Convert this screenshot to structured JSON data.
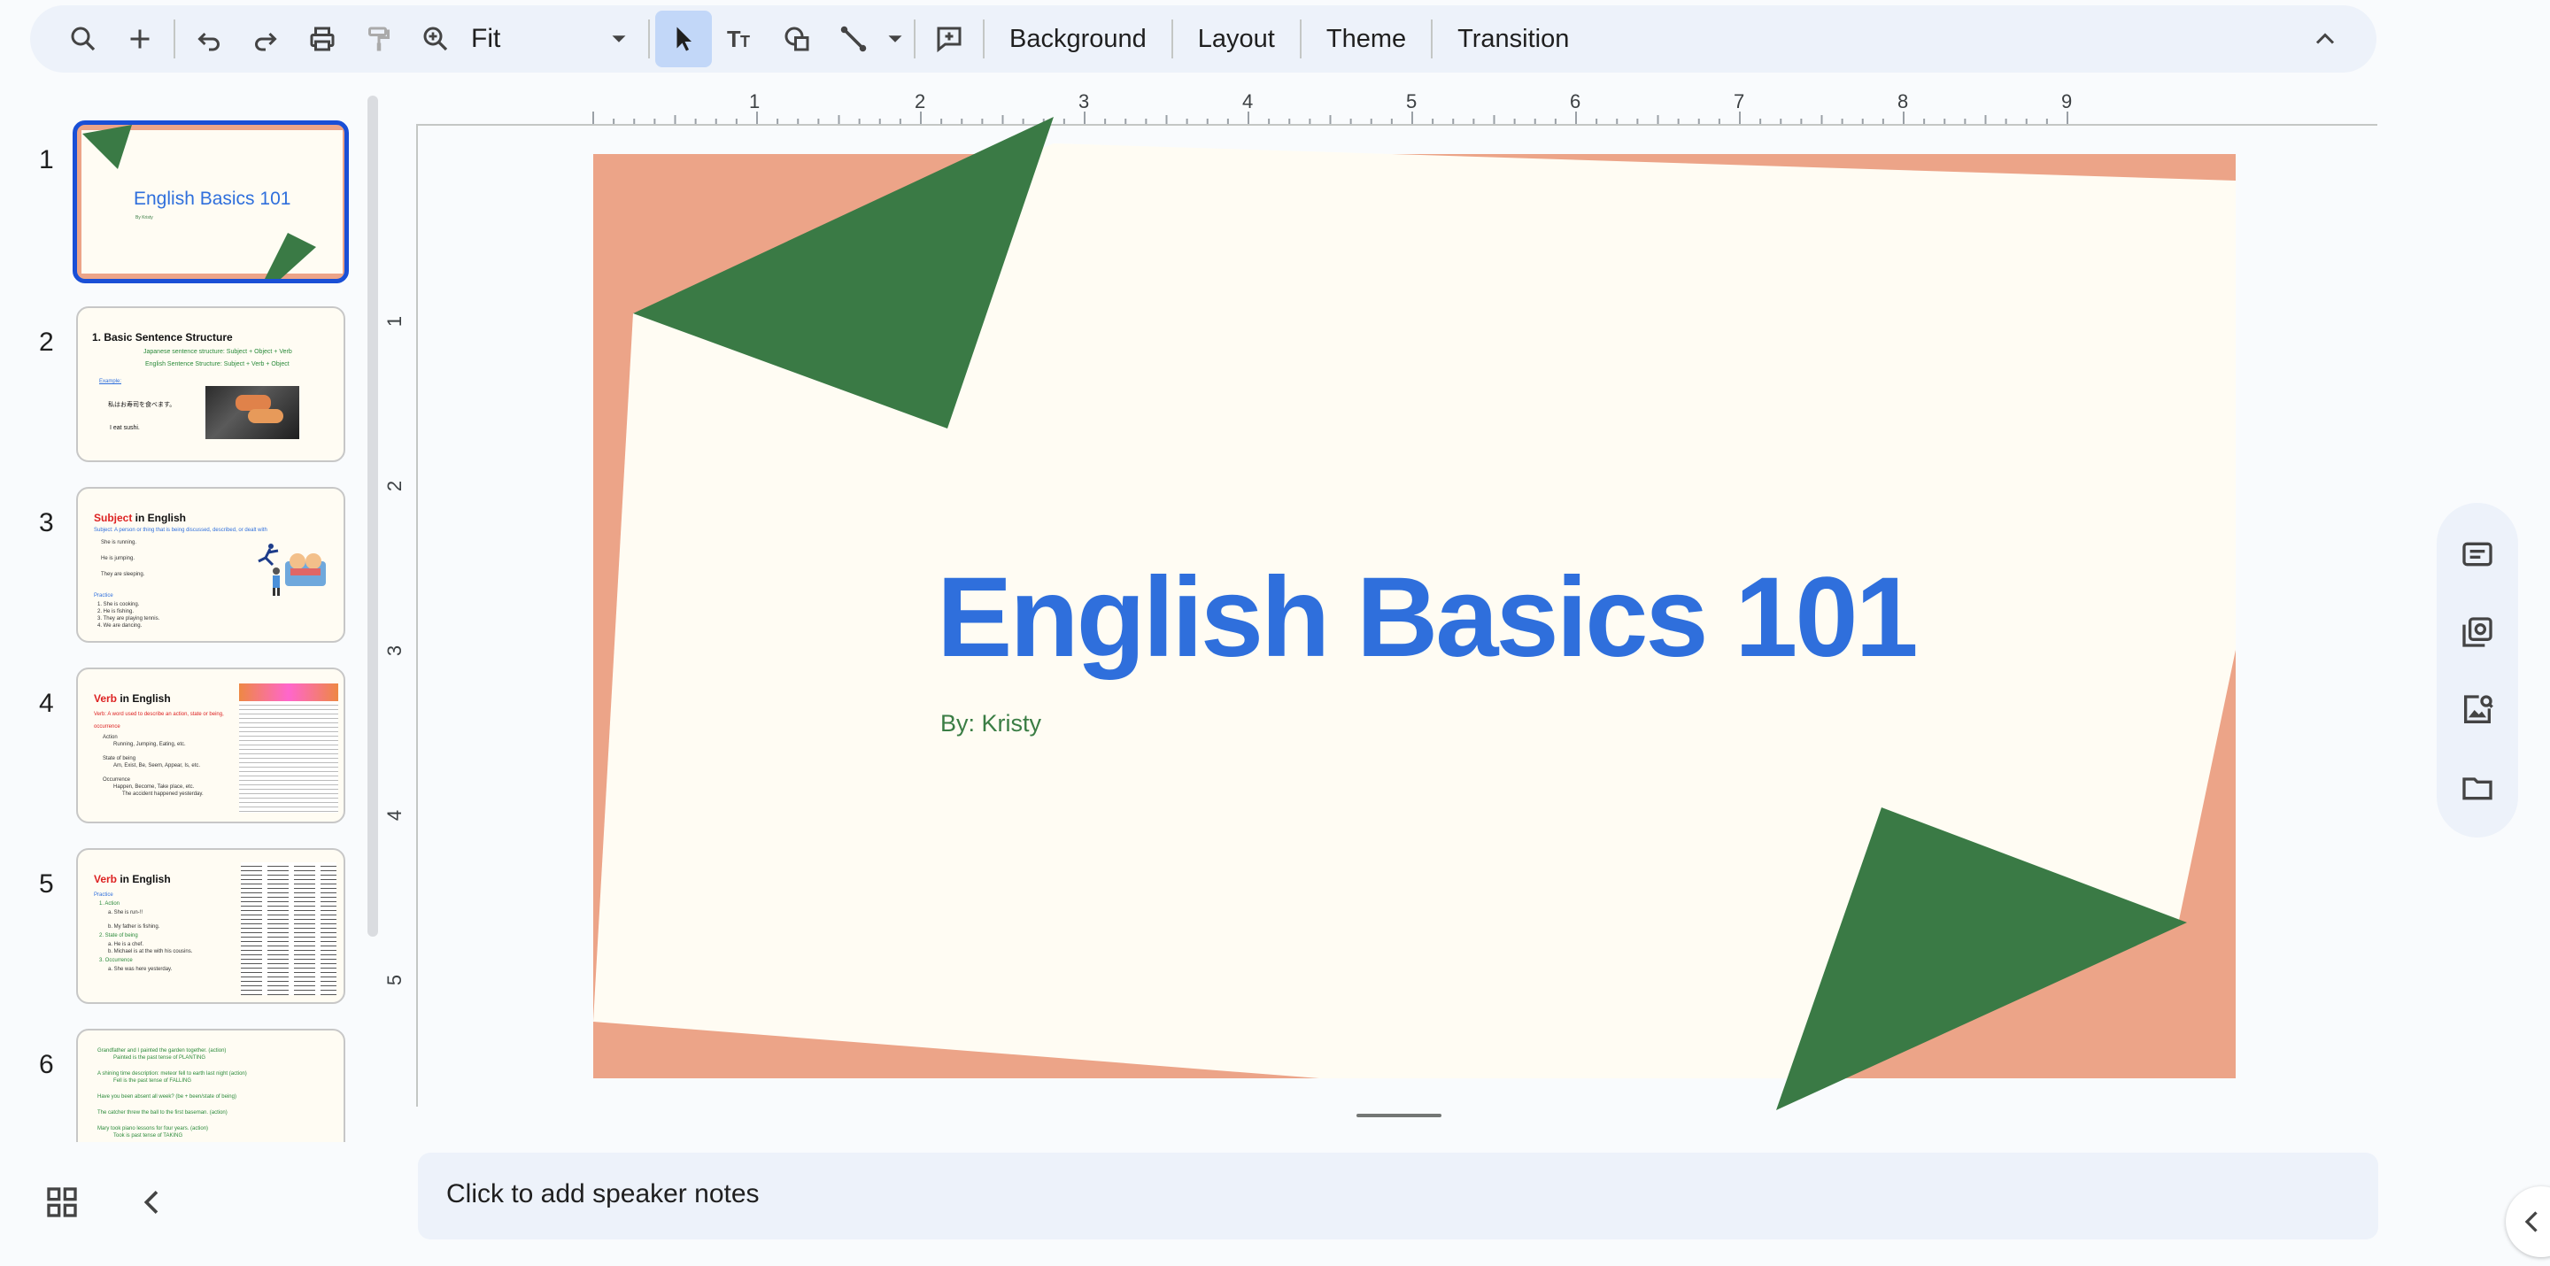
{
  "toolbar": {
    "zoom_value": "Fit",
    "background_label": "Background",
    "layout_label": "Layout",
    "theme_label": "Theme",
    "transition_label": "Transition",
    "icons": [
      "search-icon",
      "plus-icon",
      "undo-icon",
      "redo-icon",
      "print-icon",
      "paint-format-icon",
      "zoom-icon",
      "select-icon",
      "text-box-icon",
      "shape-icon",
      "line-icon",
      "comment-icon",
      "collapse-icon"
    ]
  },
  "ruler": {
    "horizontal": [
      "1",
      "2",
      "3",
      "4",
      "5",
      "6",
      "7",
      "8",
      "9"
    ],
    "vertical": [
      "1",
      "2",
      "3",
      "4",
      "5"
    ]
  },
  "filmstrip": {
    "slides": [
      {
        "number": "1",
        "title": "English Basics 101",
        "byline": "By Kristy"
      },
      {
        "number": "2",
        "title": "1.   Basic Sentence Structure",
        "line1": "Japanese sentence structure: Subject + Object + Verb",
        "line2": "English Sentence Structure: Subject + Verb + Object",
        "line3": "Example:",
        "line4": "私はお寿司を食べます。",
        "line5": "I eat sushi."
      },
      {
        "number": "3",
        "title_red": "Subject",
        "title_rest": " in English",
        "line1": "Subject: A person or thing that is being discussed, described, or dealt with",
        "b1": "She is running.",
        "b2": "He is jumping.",
        "b3": "They are sleeping.",
        "practice": "Practice",
        "p1": "1.   She is cooking.",
        "p2": "2.   He is fishing.",
        "p3": "3.   They are playing tennis.",
        "p4": "4.   We are dancing."
      },
      {
        "number": "4",
        "title_red": "Verb",
        "title_rest": " in English",
        "line1": "Verb: A word used to describe an action, state or being, occurrence",
        "b1": "Action",
        "b2": "Running, Jumping, Eating, etc.",
        "b3": "State of being",
        "b4": "Am, Exist, Be, Seem, Appear, Is, etc.",
        "b5": "Occurrence",
        "b6": "Happen, Become, Take place, etc.",
        "b7": "The accident happened yesterday."
      },
      {
        "number": "5",
        "title_red": "Verb",
        "title_rest": " in English",
        "practice": "Practice",
        "p1": "1.   Action",
        "p2": "a.   She is run-!!",
        "p3": "b.   My father is fishing.",
        "p4": "2.   State of being",
        "p5": "a.   He is a chef.",
        "p6": "b.   Michael is at the with his cousins.",
        "p7": "3.   Occurrence",
        "p8": "a.   She was here yesterday."
      },
      {
        "number": "6",
        "l1": "Grandfather and I painted the garden together. (action)",
        "l2": "Painted is the past tense of PLANTING",
        "l3": "A shining time description: meteor fell to earth last night (action)",
        "l4": "Fell is the past tense of FALLING",
        "l5": "Have you been absent all week? (be + been/state of being)",
        "l6": "The catcher threw the ball to the first baseman. (action)",
        "l7": "Mary took piano lessons for four years. (action)",
        "l8": "Took is past tense of TAKING"
      }
    ]
  },
  "slide": {
    "title": "English Basics 101",
    "subtitle": "By: Kristy"
  },
  "notes": {
    "placeholder": "Click to add speaker notes"
  },
  "colors": {
    "slide_bg": "#fffcf3",
    "slide_frame": "#eca488",
    "triangle": "#3a7a45",
    "title": "#2f6fdc",
    "subtitle": "#3a7d44",
    "selection": "#1a4fd6"
  },
  "side_panel": {
    "icons": [
      "keep-notes-icon",
      "tasks-icon",
      "image-search-icon",
      "folder-icon"
    ]
  }
}
